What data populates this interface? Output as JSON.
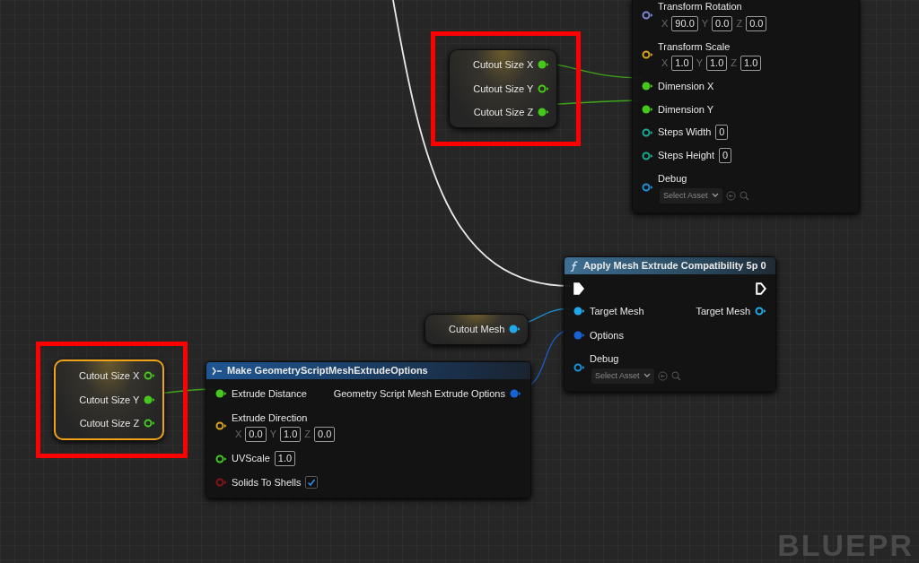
{
  "nodes": [
    {
      "kind": "function_body",
      "selected": false,
      "highlighted": false,
      "rows": [
        {
          "left": {
            "kind": "vector",
            "label": "Transform Rotation",
            "color": "#7b86d1",
            "connected": false,
            "fields": [
              {
                "axis": "X",
                "value": "90.0"
              },
              {
                "axis": "Y",
                "value": "0.0"
              },
              {
                "axis": "Z",
                "value": "0.0"
              }
            ]
          }
        },
        {
          "left": {
            "kind": "vector",
            "label": "Transform Scale",
            "color": "#d9a21b",
            "connected": false,
            "fields": [
              {
                "axis": "X",
                "value": "1.0"
              },
              {
                "axis": "Y",
                "value": "1.0"
              },
              {
                "axis": "Z",
                "value": "1.0"
              }
            ]
          }
        },
        {
          "left": {
            "kind": "data",
            "label": "Dimension X",
            "color": "#45c71c",
            "connected": true
          }
        },
        {
          "left": {
            "kind": "data",
            "label": "Dimension Y",
            "color": "#45c71c",
            "connected": true
          }
        },
        {
          "left": {
            "kind": "number",
            "label": "Steps Width",
            "color": "#1aa88c",
            "connected": false,
            "value": "0"
          }
        },
        {
          "left": {
            "kind": "number",
            "label": "Steps Height",
            "color": "#1aa88c",
            "connected": false,
            "value": "0"
          }
        },
        {
          "left": {
            "kind": "asset",
            "label": "Debug",
            "color": "#1b8fd8",
            "connected": false,
            "value": "Select Asset"
          }
        }
      ]
    },
    {
      "kind": "variable",
      "selected": false,
      "highlighted": true,
      "rows": [
        {
          "right": {
            "kind": "data",
            "label": "Cutout Size X",
            "color": "#45c71c",
            "connected": true
          }
        },
        {
          "right": {
            "kind": "data",
            "label": "Cutout Size Y",
            "color": "#45c71c",
            "connected": false
          }
        },
        {
          "right": {
            "kind": "data",
            "label": "Cutout Size Z",
            "color": "#45c71c",
            "connected": true
          }
        }
      ]
    },
    {
      "kind": "function",
      "title": "Apply Mesh Extrude Compatibility 5p 0",
      "selected": false,
      "highlighted": false,
      "rows": [
        {
          "left": {
            "kind": "exec",
            "color": "#ffffff",
            "connected": true
          },
          "right": {
            "kind": "exec",
            "color": "#ffffff",
            "connected": false
          }
        },
        {
          "left": {
            "kind": "data",
            "label": "Target Mesh",
            "color": "#22a8e8",
            "connected": true
          },
          "right": {
            "kind": "data",
            "label": "Target Mesh",
            "color": "#22a8e8",
            "connected": false
          }
        },
        {
          "left": {
            "kind": "data",
            "label": "Options",
            "color": "#1763d6",
            "connected": true
          }
        },
        {
          "left": {
            "kind": "asset",
            "label": "Debug",
            "color": "#1b8fd8",
            "connected": false,
            "value": "Select Asset"
          }
        }
      ]
    },
    {
      "kind": "variable",
      "selected": false,
      "highlighted": false,
      "rows": [
        {
          "right": {
            "kind": "data",
            "label": "Cutout Mesh",
            "color": "#22a8e8",
            "connected": true
          }
        }
      ]
    },
    {
      "kind": "variable",
      "selected": true,
      "highlighted": true,
      "rows": [
        {
          "right": {
            "kind": "data",
            "label": "Cutout Size X",
            "color": "#45c71c",
            "connected": false
          }
        },
        {
          "right": {
            "kind": "data",
            "label": "Cutout Size Y",
            "color": "#45c71c",
            "connected": true
          }
        },
        {
          "right": {
            "kind": "data",
            "label": "Cutout Size Z",
            "color": "#45c71c",
            "connected": false
          }
        }
      ]
    },
    {
      "kind": "make",
      "title": "Make GeometryScriptMeshExtrudeOptions",
      "selected": false,
      "highlighted": false,
      "rows": [
        {
          "left": {
            "kind": "data",
            "label": "Extrude Distance",
            "color": "#45c71c",
            "connected": true
          },
          "right": {
            "kind": "data",
            "label": "Geometry Script Mesh Extrude Options",
            "color": "#1763d6",
            "connected": true
          }
        },
        {
          "left": {
            "kind": "vector",
            "label": "Extrude Direction",
            "color": "#d9a21b",
            "connected": false,
            "fields": [
              {
                "axis": "X",
                "value": "0.0"
              },
              {
                "axis": "Y",
                "value": "1.0"
              },
              {
                "axis": "Z",
                "value": "0.0"
              }
            ]
          }
        },
        {
          "left": {
            "kind": "number",
            "label": "UVScale",
            "color": "#45c71c",
            "connected": false,
            "value": "1.0"
          }
        },
        {
          "left": {
            "kind": "checkbox",
            "label": "Solids To Shells",
            "color": "#8a1414",
            "connected": false,
            "checked": true
          }
        }
      ]
    }
  ],
  "graph_label": "BLUEPR"
}
